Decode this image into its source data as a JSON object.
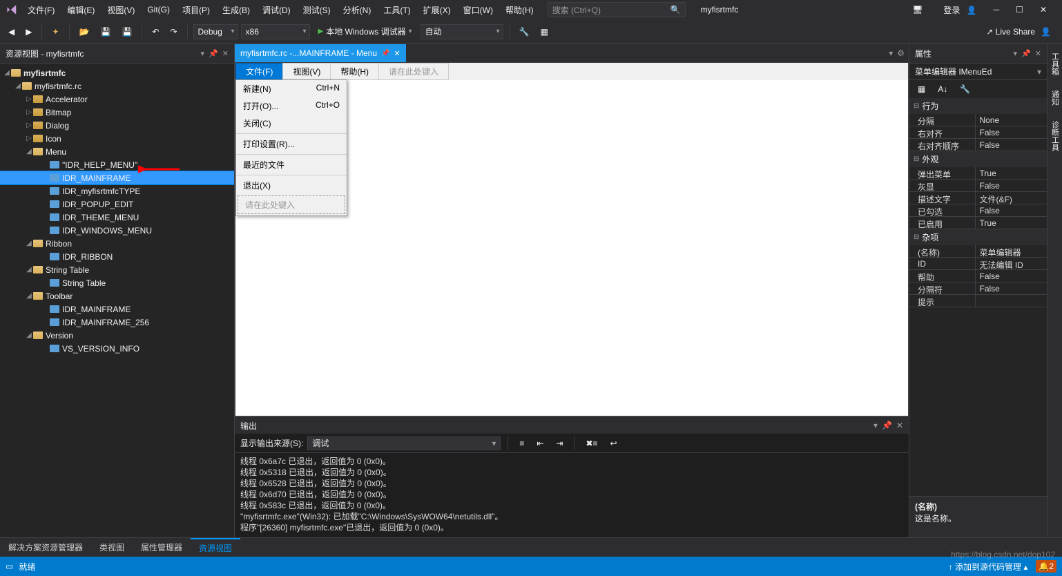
{
  "menubar": [
    "文件(F)",
    "编辑(E)",
    "视图(V)",
    "Git(G)",
    "项目(P)",
    "生成(B)",
    "调试(D)",
    "测试(S)",
    "分析(N)",
    "工具(T)",
    "扩展(X)",
    "窗口(W)",
    "帮助(H)"
  ],
  "search_placeholder": "搜索 (Ctrl+Q)",
  "project_name": "myfisrtmfc",
  "login": "登录",
  "toolbar": {
    "config": "Debug",
    "platform": "x86",
    "start": "本地 Windows 调试器",
    "auto": "自动",
    "liveshare": "Live Share"
  },
  "resource_view": {
    "title": "资源视图 - myfisrtmfc",
    "root": "myfisrtmfc",
    "rc": "myfisrtmfc.rc",
    "folders": {
      "accel": "Accelerator",
      "bitmap": "Bitmap",
      "dialog": "Dialog",
      "icon": "Icon",
      "menu": "Menu",
      "ribbon": "Ribbon",
      "strtab": "String Table",
      "toolbar": "Toolbar",
      "version": "Version"
    },
    "menu_items": [
      "\"IDR_HELP_MENU\"",
      "IDR_MAINFRAME",
      "IDR_myfisrtmfcTYPE",
      "IDR_POPUP_EDIT",
      "IDR_THEME_MENU",
      "IDR_WINDOWS_MENU"
    ],
    "ribbon_items": [
      "IDR_RIBBON"
    ],
    "strtab_items": [
      "String Table"
    ],
    "toolbar_items": [
      "IDR_MAINFRAME",
      "IDR_MAINFRAME_256"
    ],
    "version_items": [
      "VS_VERSION_INFO"
    ]
  },
  "doc_tab": "myfisrtmfc.rc -...MAINFRAME - Menu",
  "menu_editor": {
    "top": [
      "文件(F)",
      "视图(V)",
      "帮助(H)"
    ],
    "top_placeholder": "请在此处键入",
    "items": [
      {
        "label": "新建(N)",
        "accel": "Ctrl+N"
      },
      {
        "label": "打开(O)...",
        "accel": "Ctrl+O"
      },
      {
        "label": "关闭(C)",
        "accel": ""
      },
      {
        "sep": true
      },
      {
        "label": "打印设置(R)...",
        "accel": ""
      },
      {
        "sep": true
      },
      {
        "label": "最近的文件",
        "accel": ""
      },
      {
        "sep": true
      },
      {
        "label": "退出(X)",
        "accel": ""
      }
    ],
    "placeholder": "请在此处键入"
  },
  "output": {
    "title": "输出",
    "source_label": "显示输出来源(S):",
    "source": "调试",
    "lines": [
      "线程 0x6a7c 已退出，返回值为 0 (0x0)。",
      "线程 0x5318 已退出，返回值为 0 (0x0)。",
      "线程 0x6528 已退出，返回值为 0 (0x0)。",
      "线程 0x6d70 已退出，返回值为 0 (0x0)。",
      "线程 0x583c 已退出，返回值为 0 (0x0)。",
      "\"myfisrtmfc.exe\"(Win32): 已加载\"C:\\Windows\\SysWOW64\\netutils.dll\"。",
      "程序\"[26360] myfisrtmfc.exe\"已退出，返回值为 0 (0x0)。"
    ]
  },
  "properties": {
    "title": "属性",
    "subtitle": "菜单编辑器  IMenuEd",
    "cats": {
      "behavior": {
        "label": "行为",
        "rows": [
          [
            "分隔",
            "None"
          ],
          [
            "右对齐",
            "False"
          ],
          [
            "右对齐顺序",
            "False"
          ]
        ]
      },
      "appearance": {
        "label": "外观",
        "rows": [
          [
            "弹出菜单",
            "True"
          ],
          [
            "灰显",
            "False"
          ],
          [
            "描述文字",
            "文件(&F)"
          ],
          [
            "已勾选",
            "False"
          ],
          [
            "已启用",
            "True"
          ]
        ]
      },
      "misc": {
        "label": "杂项",
        "rows": [
          [
            "(名称)",
            "菜单编辑器"
          ],
          [
            "ID",
            "无法编辑 ID"
          ],
          [
            "帮助",
            "False"
          ],
          [
            "分隔符",
            "False"
          ],
          [
            "提示",
            ""
          ]
        ]
      }
    },
    "desc_title": "(名称)",
    "desc_text": "这是名称。"
  },
  "side_tabs": [
    "工具箱",
    "通知",
    "诊断工具"
  ],
  "bottom_tabs": [
    "解决方案资源管理器",
    "类视图",
    "属性管理器",
    "资源视图"
  ],
  "status": {
    "ready": "就绪",
    "source": "添加到源代码管理",
    "watermark": "https://blog.csdn.net/dop102"
  }
}
